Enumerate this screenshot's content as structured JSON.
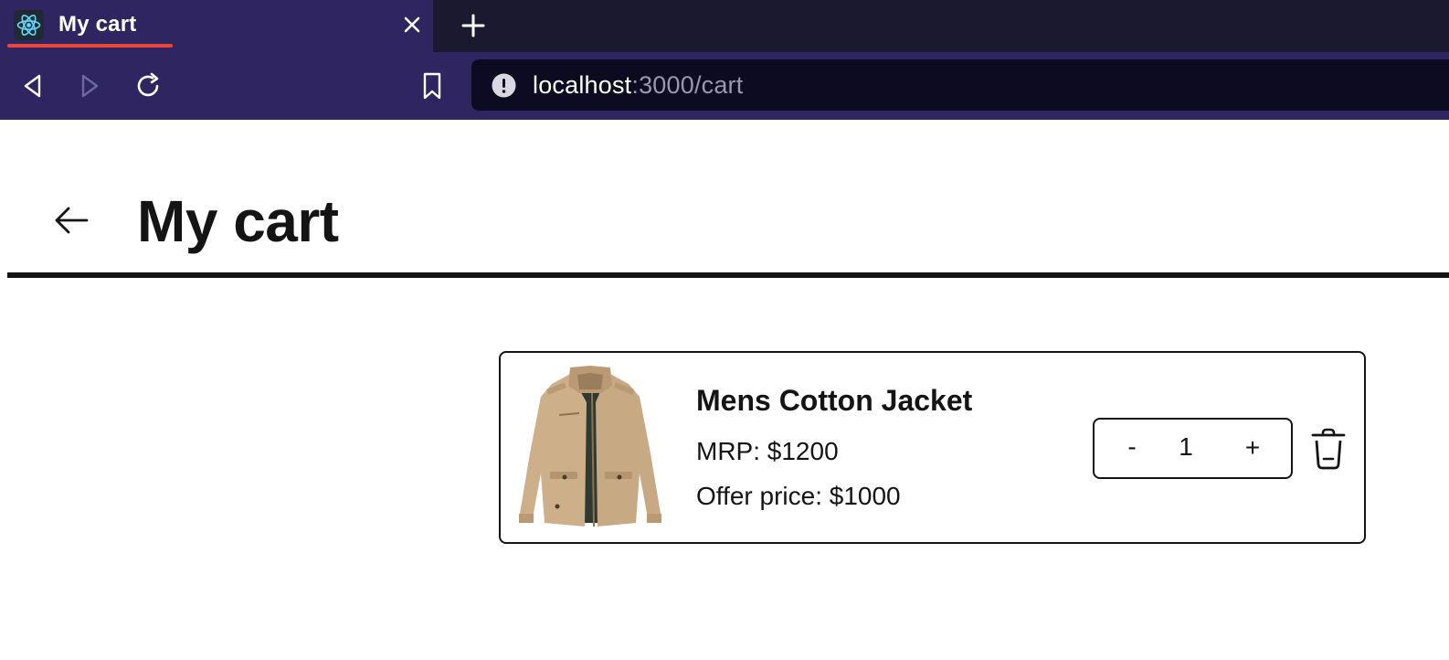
{
  "browser": {
    "tab": {
      "title": "My cart",
      "favicon": "react-logo-icon",
      "accent": "#e8473a"
    },
    "url": {
      "host": "localhost",
      "rest": ":3000/cart"
    },
    "colors": {
      "tabbar": "#1b1930",
      "toolbar": "#2f2560",
      "urlbar": "#0d0b22"
    }
  },
  "page": {
    "title": "My cart",
    "back_icon": "arrow-left-icon"
  },
  "cart": {
    "items": [
      {
        "name": "Mens Cotton Jacket",
        "mrp": "MRP: $1200",
        "offer": "Offer price: $1000",
        "quantity": "1",
        "decrement_label": "-",
        "increment_label": "+",
        "image": "jacket-image",
        "delete_icon": "trash-icon"
      }
    ]
  }
}
